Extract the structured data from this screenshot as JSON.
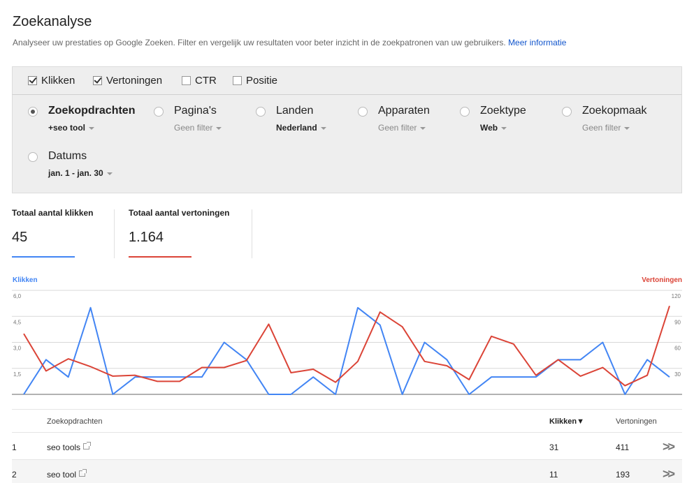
{
  "page": {
    "title": "Zoekanalyse",
    "description": "Analyseer uw prestaties op Google Zoeken. Filter en vergelijk uw resultaten voor beter inzicht in de zoekpatronen van uw gebruikers.",
    "more_info": "Meer informatie"
  },
  "metrics": [
    {
      "label": "Klikken",
      "checked": true
    },
    {
      "label": "Vertoningen",
      "checked": true
    },
    {
      "label": "CTR",
      "checked": false
    },
    {
      "label": "Positie",
      "checked": false
    }
  ],
  "dimensions": [
    {
      "label": "Zoekopdrachten",
      "filter": "+seo tool",
      "selected": true,
      "active": true
    },
    {
      "label": "Pagina's",
      "filter": "Geen filter",
      "selected": false,
      "active": false
    },
    {
      "label": "Landen",
      "filter": "Nederland",
      "selected": false,
      "active": true
    },
    {
      "label": "Apparaten",
      "filter": "Geen filter",
      "selected": false,
      "active": false
    },
    {
      "label": "Zoektype",
      "filter": "Web",
      "selected": false,
      "active": true
    },
    {
      "label": "Zoekopmaak",
      "filter": "Geen filter",
      "selected": false,
      "active": false
    },
    {
      "label": "Datums",
      "filter": "jan. 1 - jan. 30",
      "selected": false,
      "active": true
    }
  ],
  "totals": {
    "clicks": {
      "label": "Totaal aantal klikken",
      "value": "45",
      "color": "#4285f4"
    },
    "impressions": {
      "label": "Totaal aantal vertoningen",
      "value": "1.164",
      "color": "#db4437"
    }
  },
  "chart_data": {
    "type": "line",
    "x": [
      1,
      2,
      3,
      4,
      5,
      6,
      7,
      8,
      9,
      10,
      11,
      12,
      13,
      14,
      15,
      16,
      17,
      18,
      19,
      20,
      21,
      22,
      23,
      24,
      25,
      26,
      27,
      28,
      29,
      30
    ],
    "left_axis": {
      "label": "Klikken",
      "ylim": [
        0,
        6
      ],
      "ticks": [
        "6,0",
        "4,5",
        "3,0",
        "1,5"
      ],
      "tick_values": [
        6,
        4.5,
        3,
        1.5
      ]
    },
    "right_axis": {
      "label": "Vertoningen",
      "ylim": [
        0,
        120
      ],
      "ticks": [
        "120",
        "90",
        "60",
        "30"
      ],
      "tick_values": [
        120,
        90,
        60,
        30
      ]
    },
    "grid": true,
    "series": [
      {
        "name": "Klikken",
        "axis": "left",
        "color": "#4285f4",
        "values": [
          0,
          2,
          1,
          5,
          0,
          1,
          1,
          1,
          1,
          3,
          2,
          0,
          0,
          1,
          0,
          5,
          4,
          0,
          3,
          2,
          0,
          1,
          1,
          1,
          2,
          2,
          3,
          0,
          2,
          1
        ]
      },
      {
        "name": "Vertoningen",
        "axis": "left_scaled_right",
        "color": "#db4437",
        "values": [
          70,
          27,
          41,
          32,
          21,
          22,
          15,
          15,
          31,
          31,
          39,
          81,
          25,
          29,
          14,
          38,
          95,
          78,
          38,
          33,
          17,
          67,
          58,
          22,
          40,
          21,
          31,
          10,
          22,
          102
        ]
      }
    ]
  },
  "table": {
    "headers": {
      "query": "Zoekopdrachten",
      "clicks": "Klikken▼",
      "impressions": "Vertoningen"
    },
    "rows": [
      {
        "rank": "1",
        "query": "seo tools",
        "clicks": "31",
        "impressions": "411"
      },
      {
        "rank": "2",
        "query": "seo tool",
        "clicks": "11",
        "impressions": "193"
      }
    ]
  }
}
